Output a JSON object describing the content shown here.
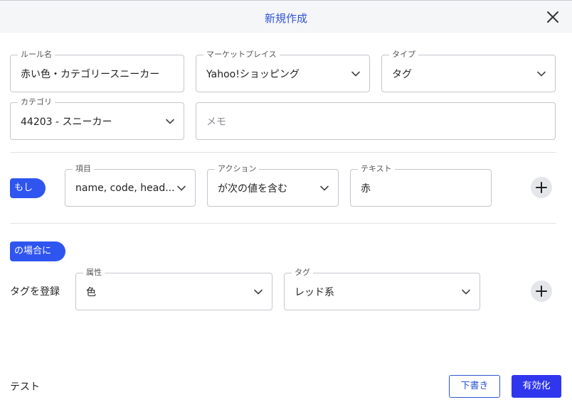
{
  "dialog": {
    "title": "新規作成"
  },
  "rule": {
    "name_label": "ルール名",
    "name_value": "赤い色・カテゴリースニーカー",
    "marketplace_label": "マーケットプレイス",
    "marketplace_value": "Yahoo!ショッピング",
    "type_label": "タイプ",
    "type_value": "タグ",
    "category_label": "カテゴリ",
    "category_value": "44203 - スニーカー",
    "memo_placeholder": "メモ"
  },
  "condition": {
    "if_label": "もし",
    "item_label": "項目",
    "item_value": "name, code, head...",
    "action_label": "アクション",
    "action_value": "が次の値を含む",
    "text_label": "テキスト",
    "text_value": "赤"
  },
  "result": {
    "when_label": "の場合に",
    "register_label": "タグを登録",
    "attribute_label": "属性",
    "attribute_value": "色",
    "tag_label": "タグ",
    "tag_value": "レッド系"
  },
  "footer": {
    "test_label": "テスト",
    "draft_label": "下書き",
    "activate_label": "有効化"
  },
  "colors": {
    "accent": "#2f55f0",
    "primary_button": "#2f36ee",
    "header_bg": "#f5f6f8"
  },
  "icons": {
    "close": "close-icon",
    "dropdown": "chevron-down-icon",
    "add": "plus-icon"
  }
}
